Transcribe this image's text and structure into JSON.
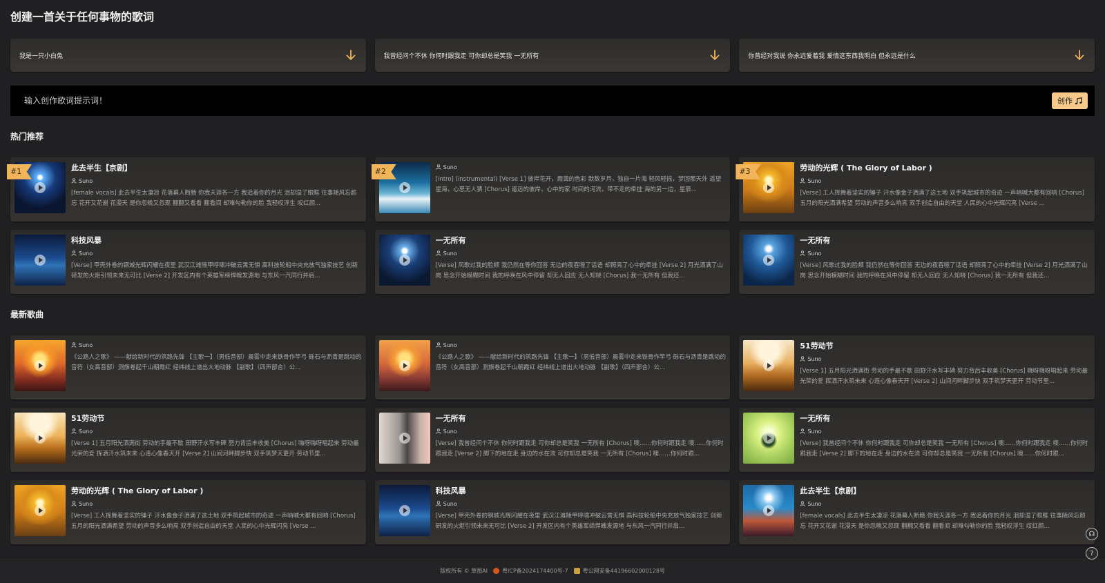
{
  "page_title": "创建一首关于任何事物的歌词",
  "suggestions": [
    {
      "text": "我是一只小白兔"
    },
    {
      "text": "我曾经问个不休 你何时跟我走 可你却总是笑我 一无所有"
    },
    {
      "text": "你曾经对我说 你永远爱着我 爱情这东西我明白 但永远是什么"
    }
  ],
  "prompt": {
    "placeholder": "输入创作歌词提示词！",
    "button_label": "创作",
    "button_icon": "music-note-icon"
  },
  "sections": {
    "hot": "热门推荐",
    "latest": "最新歌曲"
  },
  "hot_songs": [
    {
      "rank": "#1",
      "title": "此去半生【京剧】",
      "author": "Suno",
      "lyrics": "[female vocals] 此去半生太凄凉 花落幕人断肠 你我天涯各一方 我追着你的月光 泪却湿了眼眶 往事随风忘颜忘 花开又花谢 花漫天 是你忽晚又忽现 翻翻又看看 翻看间 却难勾勒你的脸 我轻叹浮生 叹红颜...",
      "cover": "night"
    },
    {
      "rank": "#2",
      "title": "",
      "author": "Suno",
      "lyrics": "[intro] (instrumental) [Verse 1] 彼岸花开，霞蔼的色彩 默数岁月，独自一片海 轻风轻摇，梦回那天外 遥望星海，心思无人猜 [Chorus] 遥远的彼岸，心中的家 时间的河流，带不走的牵挂 海的另一边，星辰...",
      "cover": "sea"
    },
    {
      "rank": "#3",
      "title": "劳动的光辉 ( The Glory of Labor )",
      "author": "Suno",
      "lyrics": "[Verse] 工人挥舞着坚实的锤子 汗水像金子洒满了这土地 双手筑起城市的奇迹 一声呐喊大都有回响 [Chorus] 五月的阳光洒满希望 劳动的声音多么响亮 双手创造自由的天堂 人民的心中光辉闪亮 [Verse ...",
      "cover": "field"
    },
    {
      "rank": "",
      "title": "科技风暴",
      "author": "Suno",
      "lyrics": "[Verse] 甲壳外卷的钢城光辉闪耀在夜里 武汉江滩随甲呼啸冲破云霄无惧 高科技轮船中央充放气独家技艺 创新研发的火炬引领未来无可比 [Verse 2] 开发区内有个英雄军缔悍魄发源地 与东风一汽同行并肩...",
      "cover": "tech"
    },
    {
      "rank": "",
      "title": "一无所有",
      "author": "Suno",
      "lyrics": "[Verse] 风歌过我的脸颊 我仍然在等你回答 无边的夜吞噬了话语 却照亮了心中的牵挂 [Verse 2] 月光洒满了山岗 思念开始模糊时间 我的呼唤在风中停留 却无人回应 无人知晓 [Chorus] 我一无所有 但我还...",
      "cover": "moon"
    },
    {
      "rank": "",
      "title": "一无所有",
      "author": "Suno",
      "lyrics": "[Verse] 风歌过我的脸颊 我仍然在等你回答 无边的夜吞噬了话语 却照亮了心中的牵挂 [Verse 2] 月光洒满了山岗 思念开始模糊时间 我的呼唤在风中停留 却无人回应 无人知晓 [Chorus] 我一无所有 但我还...",
      "cover": "moon2"
    }
  ],
  "latest_songs": [
    {
      "title": "",
      "author": "Suno",
      "lyrics": "《公路人之歌》 ——献给新时代的筑路先锋 【主歌一】（男低音部）晨雾中走来铁骨作竿弓 砾石与沥青是跳动的音符（女高音部）测旗卷起千山朝霞红 经纬线上谱出大地动脉 【副歌】（四声部合）公...",
      "cover": "sunset"
    },
    {
      "title": "",
      "author": "Suno",
      "lyrics": "《公路人之歌》 ——献给新时代的筑路先锋 【主歌一】（男低音部）晨雾中走来铁骨作竿弓 砾石与沥青是跳动的音符（女高音部）测旗卷起千山朝霞红 经纬线上谱出大地动脉 【副歌】（四声部合）公...",
      "cover": "sunset2"
    },
    {
      "title": "51劳动节",
      "author": "Suno",
      "lyrics": "[Verse 1] 五月阳光洒满街 劳动的手最不歇 田野汗水写丰碑 努力背后丰收美 [Chorus] 嗨呀嗨呀唱起来 劳动最光荣的爱 挥洒汗水筑未来 心连心像春天开 [Verse 2] 山间河畔脚步快 双手筑梦天更开 劳动节里...",
      "cover": "flowers"
    },
    {
      "title": "51劳动节",
      "author": "Suno",
      "lyrics": "[Verse 1] 五月阳光洒满街 劳动的手最不歇 田野汗水写丰碑 努力背后丰收美 [Chorus] 嗨呀嗨呀唱起来 劳动最光荣的爱 挥洒汗水筑未来 心连心像春天开 [Verse 2] 山间河畔脚步快 双手筑梦天更开 劳动节里...",
      "cover": "flowers2"
    },
    {
      "title": "一无所有",
      "author": "Suno",
      "lyrics": "[Verse] 我曾经问个不休 你何时跟我走 可你却总是笑我 一无所有 [Chorus] 噢……你何时跟我走 噢……你何时跟我走 [Verse 2] 脚下的地在走 身边的水在流 可你却总是笑我 一无所有 [Chorus] 噢……你何时跟...",
      "cover": "lighthouse"
    },
    {
      "title": "一无所有",
      "author": "Suno",
      "lyrics": "[Verse] 我曾经问个不休 你何时跟我走 可你却总是笑我 一无所有 [Chorus] 噢……你何时跟我走 噢……你何时跟我走 [Verse 2] 脚下的地在走 身边的水在流 可你却总是笑我 一无所有 [Chorus] 噢……你何时跟...",
      "cover": "island"
    },
    {
      "title": "劳动的光辉 ( The Glory of Labor )",
      "author": "Suno",
      "lyrics": "[Verse] 工人挥舞着坚实的锤子 汗水像金子洒满了这土地 双手筑起城市的奇迹 一声呐喊大都有回响 [Chorus] 五月的阳光洒满希望 劳动的声音多么响亮 双手创造自由的天堂 人民的心中光辉闪亮 [Verse ...",
      "cover": "field"
    },
    {
      "title": "科技风暴",
      "author": "Suno",
      "lyrics": "[Verse] 甲壳外卷的钢城光辉闪耀在夜里 武汉江滩随甲呼啸冲破云霄无惧 高科技轮船中央充放气独家技艺 创新研发的火炬引领未来无可比 [Verse 2] 开发区内有个英雄军缔悍魄发源地 与东风一汽同行并肩...",
      "cover": "tech"
    },
    {
      "title": "此去半生【京剧】",
      "author": "Suno",
      "lyrics": "[female vocals] 此去半生太凄凉 花落幕人断肠 你我天涯各一方 我追着你的月光 泪却湿了眼眶 往事随风忘颜忘 花开又花谢 花漫天 是你忽晚又忽现 翻翻又看看 翻看间 却难勾勒你的脸 我轻叹浮生 叹红颜...",
      "cover": "lake"
    }
  ],
  "footer": {
    "copyright": "版权所有 © 草图AI",
    "icp": "粤ICP备2024174400号-7",
    "police": "粤公网安备44196602000128号"
  },
  "colors": {
    "accent": "#f7c98a",
    "badge": "#f2b458",
    "background": "#202022"
  }
}
